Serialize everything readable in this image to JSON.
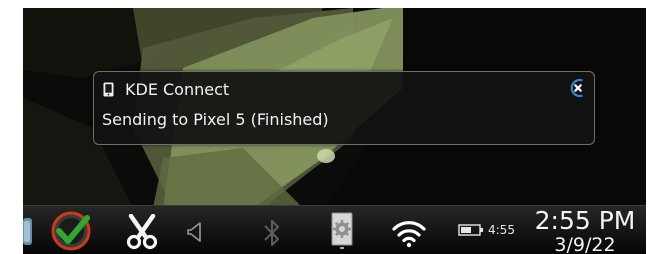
{
  "notification": {
    "app_name": "KDE Connect",
    "body": "Sending to Pixel 5 (Finished)",
    "app_icon": "smartphone-icon",
    "close_icon": "close-icon"
  },
  "panel": {
    "launcher_icon": "launcher-icon",
    "tray_icons": [
      "kde-connect-checkmark-icon",
      "cut-scissors-icon",
      "volume-speaker-icon",
      "bluetooth-icon",
      "settings-gear-icon",
      "wifi-icon",
      "battery-icon"
    ],
    "battery_time": "4:55",
    "clock_time": "2:55 PM",
    "clock_date": "3/9/22"
  },
  "colors": {
    "panel_top": "#262626",
    "panel_bottom": "#050505",
    "notification_bg": "#121212",
    "notification_border": "#6f6f6f",
    "text": "#f2f2f2",
    "close_accent": "#3b7fd0",
    "check_green": "#2ea82e",
    "ring_red": "#cc3a1c"
  }
}
